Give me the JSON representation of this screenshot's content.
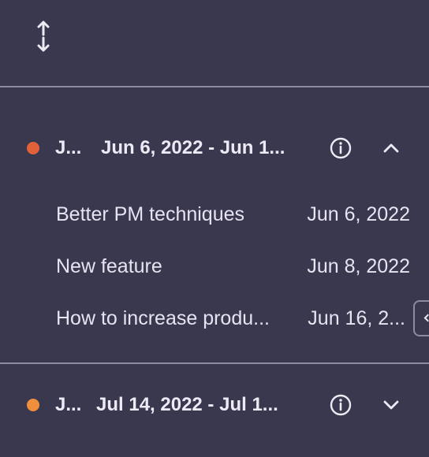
{
  "toolbar": {
    "expand_icon": "expand-vertical-icon"
  },
  "groups": [
    {
      "name": "J...",
      "range": "Jun 6, 2022 - Jun 1...",
      "color": "#e0613a",
      "info_icon": "info-circle-icon",
      "toggle_icon": "chevron-up-icon",
      "expanded": true,
      "items": [
        {
          "title": "Better PM techniques",
          "date": "Jun 6, 2022"
        },
        {
          "title": "New feature",
          "date": "Jun 8, 2022"
        },
        {
          "title": "How to increase produ...",
          "date": "Jun 16, 2..."
        }
      ]
    },
    {
      "name": "J...",
      "range": "Jul 14, 2022 - Jul 1...",
      "color": "#f08f3b",
      "info_icon": "info-circle-icon",
      "toggle_icon": "chevron-down-icon",
      "expanded": false,
      "items": []
    }
  ]
}
